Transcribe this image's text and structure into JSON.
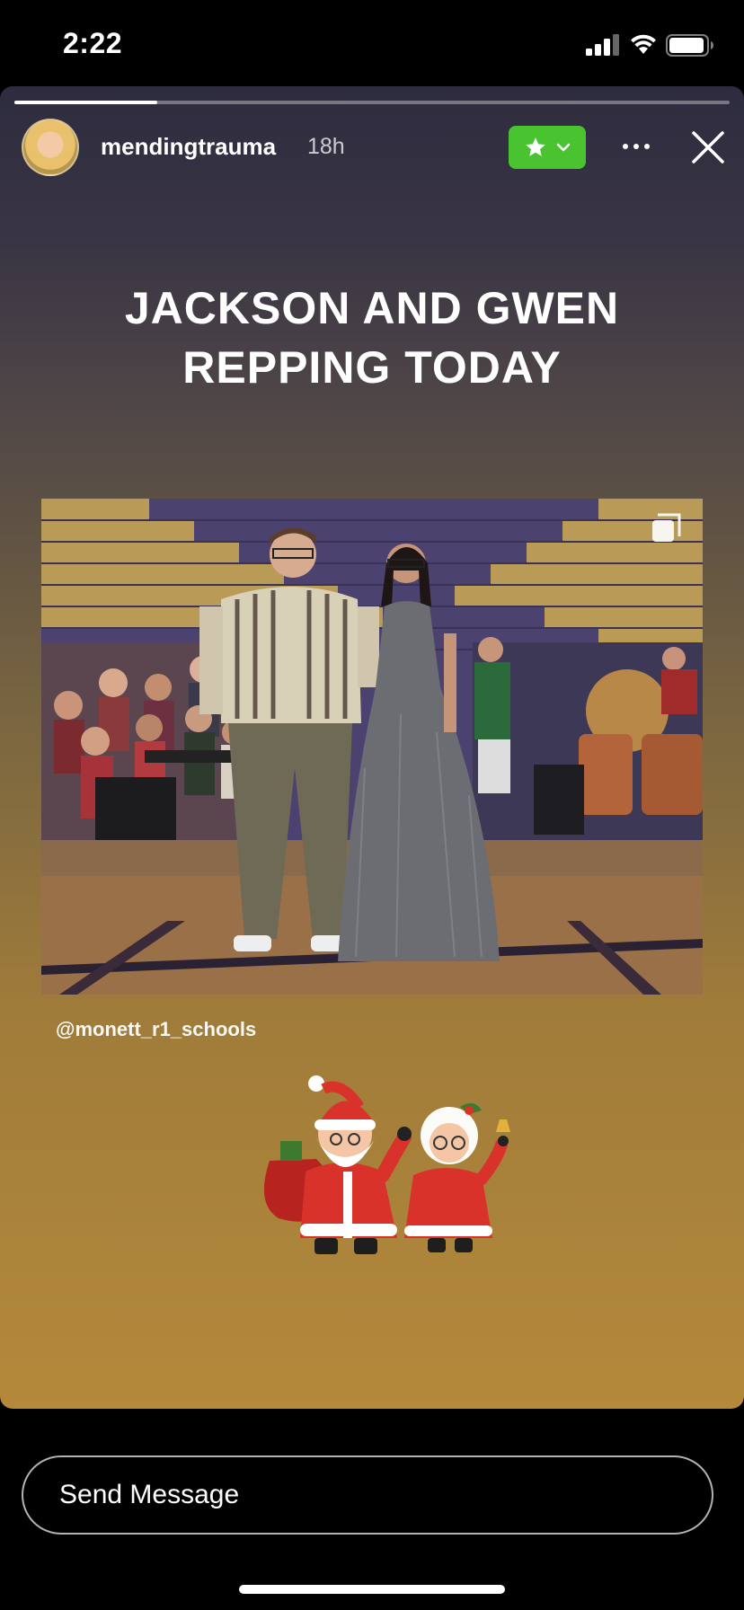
{
  "status_bar": {
    "time": "2:22",
    "icons": [
      "cellular-signal-icon",
      "wifi-icon",
      "battery-icon"
    ]
  },
  "story": {
    "progress_fraction": 0.2,
    "username": "mendingtrauma",
    "timestamp": "18h",
    "close_friends_badge_icon": "star-icon",
    "headline_lines": [
      "JACKSON AND GWEN",
      "REPPING TODAY"
    ],
    "photo_tag": "@monett_r1_schools",
    "sticker_icon": "santa-and-mrs-claus-sticker",
    "colors": {
      "gradient_top": "#2d2c3e",
      "gradient_bottom": "#b4893b",
      "close_friends_green": "#4ac330"
    }
  },
  "message_bar": {
    "placeholder": "Send Message"
  }
}
